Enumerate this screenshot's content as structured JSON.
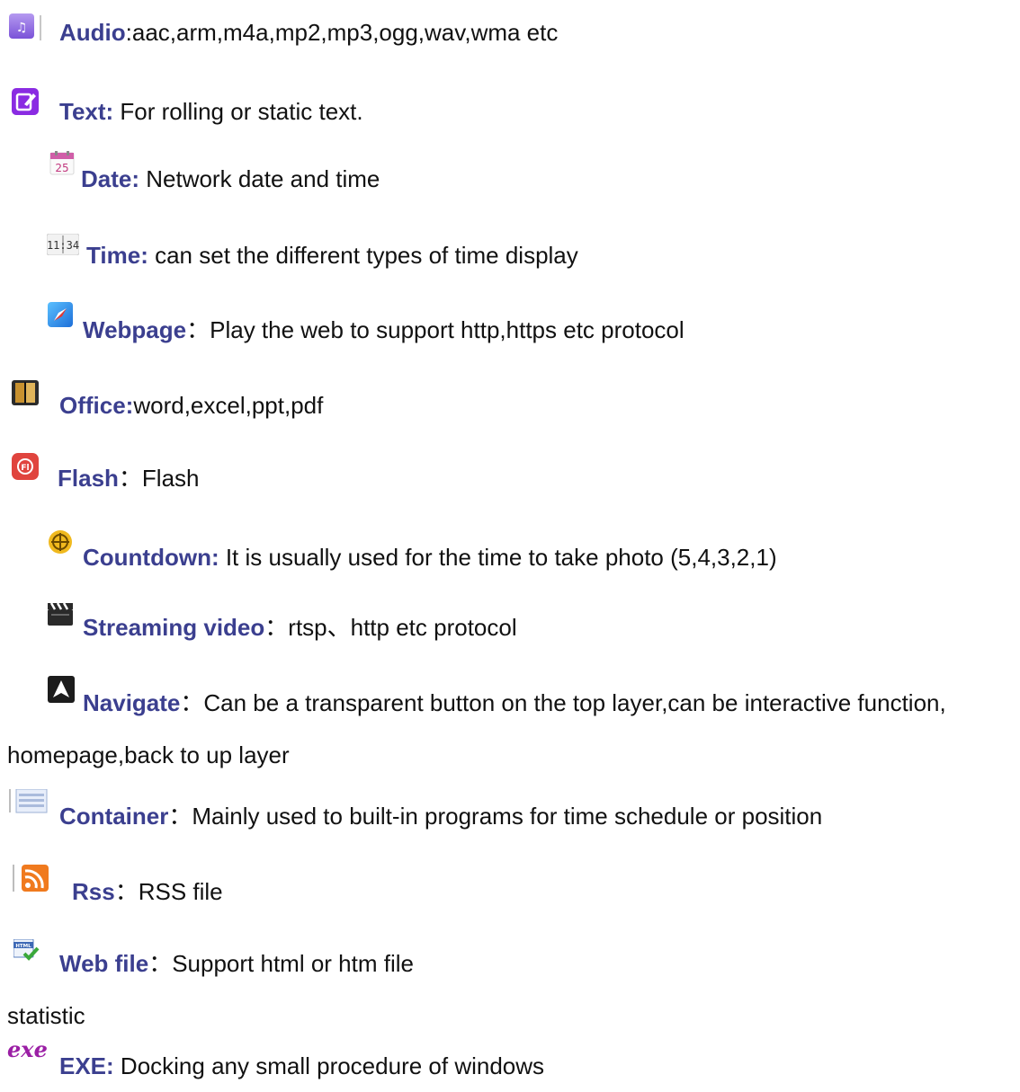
{
  "items": [
    {
      "icon": "music-note-icon",
      "label": "Audio",
      "desc": ":aac,arm,m4a,mp2,mp3,ogg,wav,wma etc"
    },
    {
      "icon": "edit-icon",
      "label": "Text:",
      "desc": " For rolling or static text."
    },
    {
      "icon": "calendar-icon",
      "label": "Date:",
      "desc": " Network date and time",
      "icon_text": "25"
    },
    {
      "icon": "clock-digits-icon",
      "label": "Time:",
      "desc": " can set the different types of time display",
      "icon_text": "11:34"
    },
    {
      "icon": "compass-icon",
      "label": "Webpage",
      "desc": "：Play the web to support http,https etc protocol"
    },
    {
      "icon": "book-icon",
      "label": "Office:",
      "desc": "word,excel,ppt,pdf"
    },
    {
      "icon": "flash-icon",
      "label": "Flash",
      "desc": "：Flash",
      "icon_text": "Fl"
    },
    {
      "icon": "countdown-icon",
      "label": "Countdown:",
      "desc": " It is usually used for the time to take photo (5,4,3,2,1)"
    },
    {
      "icon": "clapperboard-icon",
      "label": "Streaming video",
      "desc": "：rtsp、http etc protocol"
    },
    {
      "icon": "navigate-icon",
      "label": "Navigate",
      "desc": "：Can be a transparent button on the top layer,can be interactive function,"
    },
    {
      "icon": "container-icon",
      "label": "Container",
      "desc": "：Mainly used to built-in programs for time schedule or position"
    },
    {
      "icon": "rss-icon",
      "label": "Rss",
      "desc": "：RSS file"
    },
    {
      "icon": "html-file-icon",
      "label": "Web file",
      "desc": "：Support html or htm file",
      "icon_text": "HTML"
    },
    {
      "icon": "exe-icon",
      "label": "EXE:",
      "desc": " Docking any small procedure of windows",
      "icon_text": "exe"
    }
  ],
  "navigate_continuation": "homepage,back to up layer",
  "statistic_text": "statistic",
  "colors": {
    "label": "#3b3f8f",
    "text": "#111111"
  }
}
